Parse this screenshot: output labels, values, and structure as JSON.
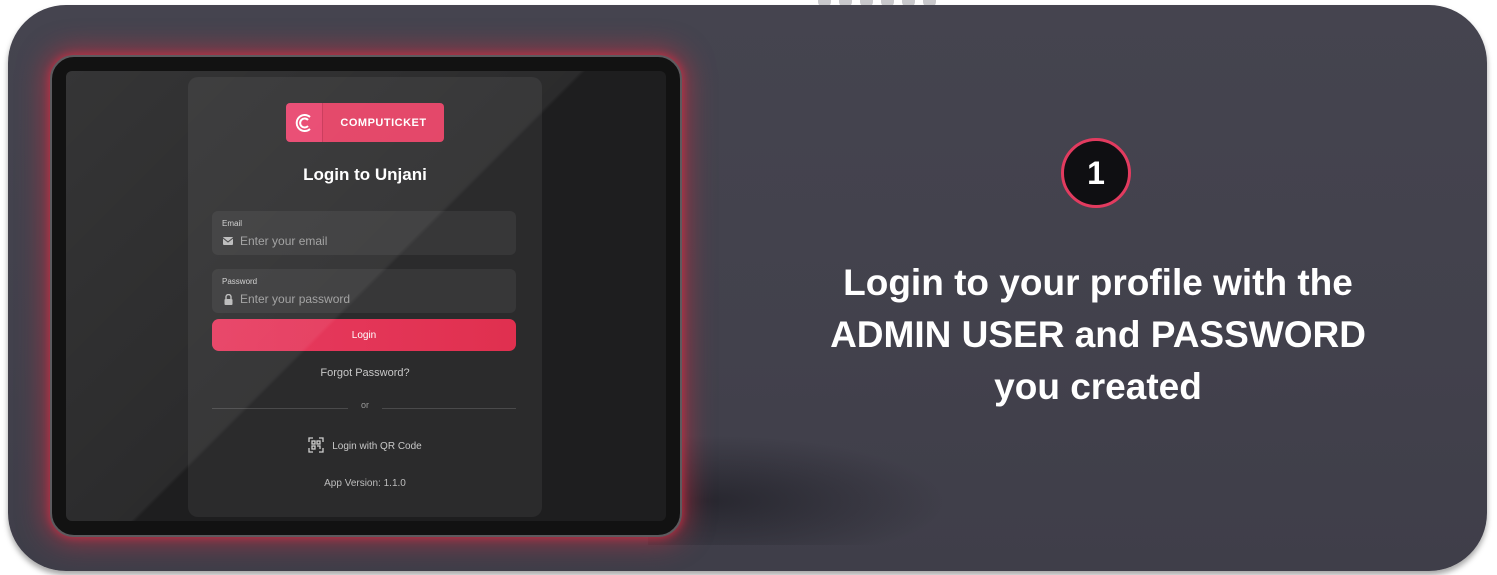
{
  "brand": {
    "name": "COMPUTICKET",
    "accent": "#e23b5f"
  },
  "login": {
    "title": "Login to Unjani",
    "email_label": "Email",
    "email_placeholder": "Enter your email",
    "password_label": "Password",
    "password_placeholder": "Enter your password",
    "login_button": "Login",
    "forgot": "Forgot Password?",
    "or": "or",
    "qr_login": "Login with QR Code",
    "app_version": "App Version: 1.1.0"
  },
  "step": {
    "number": "1",
    "text_line1": "Login to your profile with the",
    "text_line2": "ADMIN USER and PASSWORD",
    "text_line3": "you created"
  },
  "icons": [
    "computicket-logo-icon",
    "mail-icon",
    "lock-icon",
    "qr-code-icon"
  ]
}
